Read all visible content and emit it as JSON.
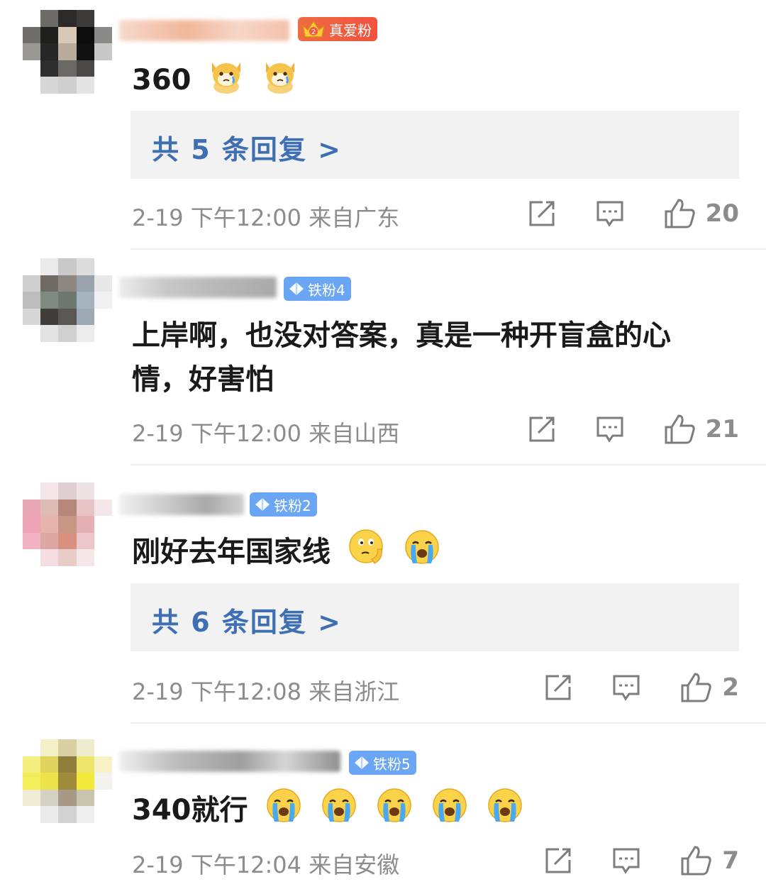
{
  "comments": [
    {
      "badge": "真爱粉",
      "badge_level": "2",
      "badge_type": "love",
      "content": "360",
      "emojis": [
        "dog-crying-emoji",
        "dog-crying-emoji"
      ],
      "replies_label": "共 5 条回复 >",
      "timestamp": "2-19 下午12:00 来自广东",
      "likes": "20"
    },
    {
      "badge": "铁粉4",
      "badge_type": "fan",
      "content": "上岸啊，也没对答案，真是一种开盲盒的心情，好害怕",
      "emojis": [],
      "timestamp": "2-19 下午12:00 来自山西",
      "likes": "21"
    },
    {
      "badge": "铁粉2",
      "badge_type": "fan",
      "content": "刚好去年国家线",
      "emojis": [
        "thinking-emoji",
        "crying-emoji"
      ],
      "replies_label": "共 6 条回复 >",
      "timestamp": "2-19 下午12:08 来自浙江",
      "likes": "2"
    },
    {
      "badge": "铁粉5",
      "badge_type": "fan",
      "content": "340就行",
      "emojis": [
        "crying-emoji",
        "crying-emoji",
        "crying-emoji",
        "crying-emoji",
        "crying-emoji"
      ],
      "timestamp": "2-19 下午12:04 来自安徽",
      "likes": "7"
    }
  ],
  "colors": {
    "reply_link": "#3f6fb3",
    "fan_badge": "#6ba6f5",
    "love_badge": "#f0523e",
    "meta_text": "#8c8c8c"
  }
}
